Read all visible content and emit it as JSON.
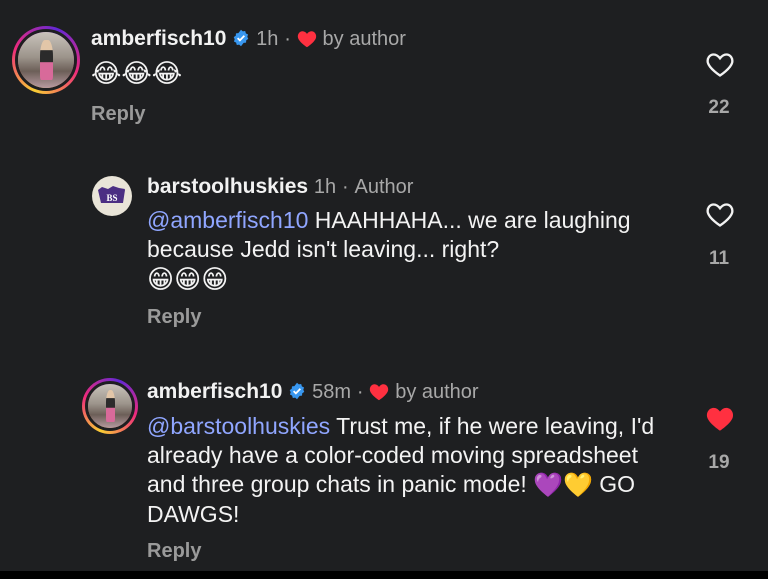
{
  "comments": [
    {
      "username": "amberfisch10",
      "time": "1h",
      "separator": "·",
      "author_like_label": "by author",
      "emoji_text": "😂😂😂",
      "reply_label": "Reply",
      "like_count": "22",
      "liked": false
    },
    {
      "username": "barstoolhuskies",
      "time": "1h",
      "separator": "·",
      "author_badge": "Author",
      "mention": "@amberfisch10",
      "text": " HAAHHAHA... we are laughing because Jedd isn't leaving... right?",
      "emoji_text": "😁😁😁",
      "reply_label": "Reply",
      "like_count": "11",
      "liked": false
    },
    {
      "username": "amberfisch10",
      "time": "58m",
      "separator": "·",
      "author_like_label": "by author",
      "mention": "@barstoolhuskies",
      "text": "  Trust me, if he were leaving, I'd already have a color-coded moving spreadsheet and three group chats in panic mode!",
      "emoji_text": "💜💛",
      "text_end": " GO DAWGS!",
      "reply_label": "Reply",
      "like_count": "19",
      "liked": true
    }
  ],
  "colors": {
    "background": "#1e1f21",
    "mention": "#90a6ff",
    "liked_heart": "#ff3040",
    "verified": "#3897f0",
    "muted": "#a8a8a8"
  },
  "icons": [
    "verified-badge-icon",
    "red-heart-icon",
    "heart-outline-icon",
    "heart-filled-icon"
  ]
}
